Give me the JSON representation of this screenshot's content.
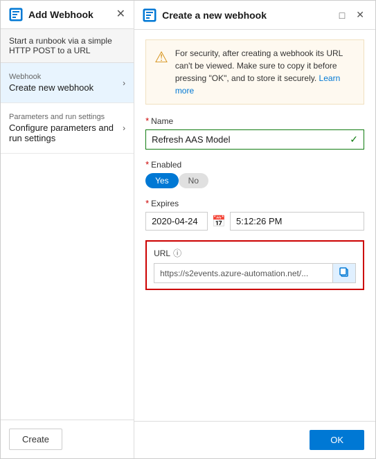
{
  "left": {
    "title": "Add Webhook",
    "subtitle": "Start a runbook via a simple HTTP POST to a URL",
    "nav": [
      {
        "label": "Webhook",
        "title": "Create new webhook",
        "active": true
      },
      {
        "label": "Parameters and run settings",
        "title": "Configure parameters and run settings",
        "active": false
      }
    ],
    "create_button": "Create"
  },
  "right": {
    "title": "Create a new webhook",
    "warning": {
      "text": "For security, after creating a webhook its URL can't be viewed. Make sure to copy it before pressing \"OK\", and to store it securely.",
      "link_text": "Learn more"
    },
    "name_label": "Name",
    "name_value": "Refresh AAS Model",
    "enabled_label": "Enabled",
    "toggle_yes": "Yes",
    "toggle_no": "No",
    "expires_label": "Expires",
    "expires_date": "2020-04-24",
    "expires_time": "5:12:26 PM",
    "url_label": "URL",
    "url_value": "https://s2events.azure-automation.net/...",
    "ok_button": "OK"
  }
}
